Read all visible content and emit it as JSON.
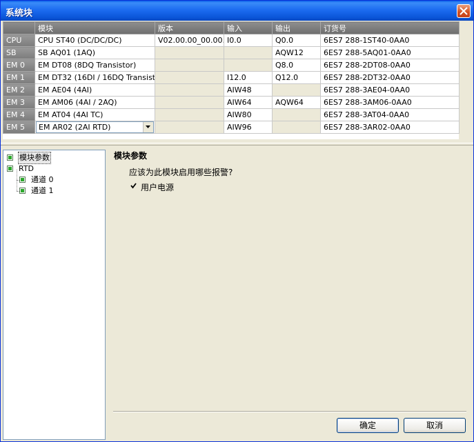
{
  "window": {
    "title": "系统块"
  },
  "grid": {
    "columns": [
      "",
      "模块",
      "版本",
      "输入",
      "输出",
      "订货号"
    ],
    "rows": [
      {
        "slot": "CPU",
        "module": "CPU ST40 (DC/DC/DC)",
        "version": "V02.00.00_00.00...",
        "input": "I0.0",
        "output": "Q0.0",
        "order": "6ES7 288-1ST40-0AA0"
      },
      {
        "slot": "SB",
        "module": "SB AQ01 (1AQ)",
        "version": "",
        "input": "",
        "output": "AQW12",
        "order": "6ES7 288-5AQ01-0AA0"
      },
      {
        "slot": "EM 0",
        "module": "EM DT08 (8DQ Transistor)",
        "version": "",
        "input": "",
        "output": "Q8.0",
        "order": "6ES7 288-2DT08-0AA0"
      },
      {
        "slot": "EM 1",
        "module": "EM DT32 (16DI / 16DQ Transistor)",
        "version": "",
        "input": "I12.0",
        "output": "Q12.0",
        "order": "6ES7 288-2DT32-0AA0"
      },
      {
        "slot": "EM 2",
        "module": "EM AE04 (4AI)",
        "version": "",
        "input": "AIW48",
        "output": "",
        "order": "6ES7 288-3AE04-0AA0"
      },
      {
        "slot": "EM 3",
        "module": "EM AM06 (4AI / 2AQ)",
        "version": "",
        "input": "AIW64",
        "output": "AQW64",
        "order": "6ES7 288-3AM06-0AA0"
      },
      {
        "slot": "EM 4",
        "module": "EM AT04 (4AI TC)",
        "version": "",
        "input": "AIW80",
        "output": "",
        "order": "6ES7 288-3AT04-0AA0"
      },
      {
        "slot": "EM 5",
        "module": "EM AR02 (2AI RTD)",
        "version": "",
        "input": "AIW96",
        "output": "",
        "order": "6ES7 288-3AR02-0AA0"
      }
    ]
  },
  "tree": {
    "items": [
      {
        "label": "模块参数",
        "selected": true
      },
      {
        "label": "RTD"
      },
      {
        "label": "通道 0"
      },
      {
        "label": "通道 1"
      }
    ]
  },
  "panel": {
    "title": "模块参数",
    "question": "应该为此模块启用哪些报警?",
    "checkbox_label": "用户电源",
    "checkbox_checked": true
  },
  "buttons": {
    "ok": "确定",
    "cancel": "取消"
  },
  "icons": {
    "close": "close-icon",
    "tree_node": "module-node-icon",
    "dropdown": "chevron-down-icon"
  }
}
